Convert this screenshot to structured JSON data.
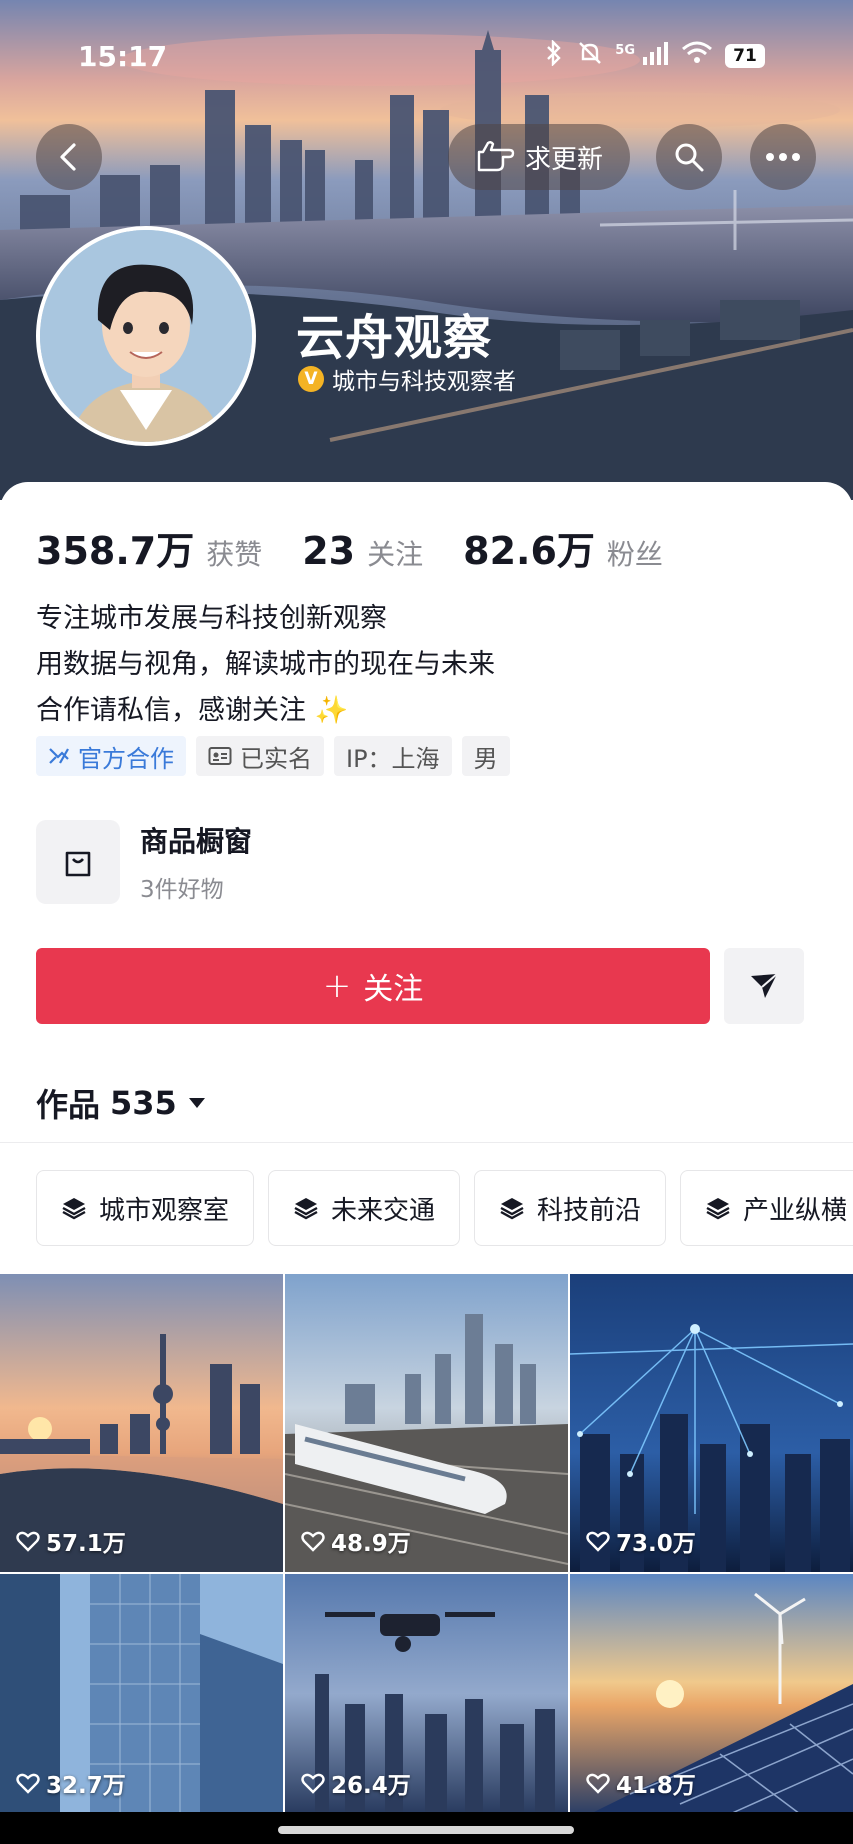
{
  "status_bar": {
    "time": "15:17",
    "network": "5G",
    "battery": "71"
  },
  "header": {
    "update_label": "求更新"
  },
  "profile": {
    "name": "云舟观察",
    "verify_badge": "V",
    "verified_title": "城市与科技观察者"
  },
  "stats": [
    {
      "value": "358.7万",
      "label": "获赞"
    },
    {
      "value": "23",
      "label": "关注"
    },
    {
      "value": "82.6万",
      "label": "粉丝"
    }
  ],
  "bio": [
    "专注城市发展与科技创新观察",
    "用数据与视角，解读城市的现在与未来",
    "合作请私信，感谢关注 ✨"
  ],
  "tags": [
    {
      "label": "官方合作",
      "icon": "cooperation-icon"
    },
    {
      "label": "已实名",
      "icon": "id-card-icon"
    },
    {
      "label": "IP：上海"
    },
    {
      "label": "男"
    }
  ],
  "shop": {
    "title": "商品橱窗",
    "subtitle": "3件好物"
  },
  "follow": {
    "plus": "+",
    "label": "关注"
  },
  "works": {
    "label": "作品",
    "count": "535"
  },
  "collections": [
    {
      "label": "城市观察室",
      "icon": "layers-icon"
    },
    {
      "label": "未来交通",
      "icon": "layers-icon"
    },
    {
      "label": "科技前沿",
      "icon": "layers-icon"
    },
    {
      "label": "产业纵横",
      "icon": "layers-icon"
    }
  ],
  "videos": [
    {
      "likes": "57.1万",
      "scene": "river-sunset"
    },
    {
      "likes": "48.9万",
      "scene": "bullet-train"
    },
    {
      "likes": "73.0万",
      "scene": "network-city"
    },
    {
      "likes": "32.7万",
      "scene": "glass-building"
    },
    {
      "likes": "26.4万",
      "scene": "drone-city"
    },
    {
      "likes": "41.8万",
      "scene": "solar-wind"
    }
  ]
}
